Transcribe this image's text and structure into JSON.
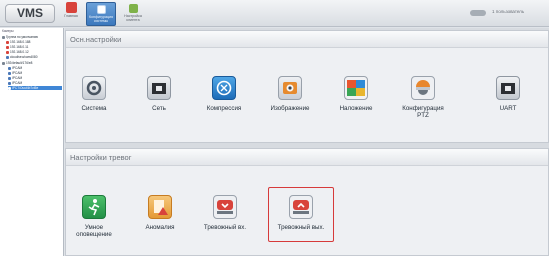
{
  "app": {
    "logo": "VMS"
  },
  "toolbar": {
    "buttons": [
      {
        "label": "Главная",
        "icon": "home-icon"
      },
      {
        "label": "Конфигурация системы",
        "icon": "config-icon"
      },
      {
        "label": "Настройка клиента",
        "icon": "client-icon"
      }
    ],
    "right_text": "1 пользователь"
  },
  "tree": {
    "header": "Камеры",
    "rows": [
      {
        "label": "Группа по умолчанию",
        "icon": "folder-icon"
      },
      {
        "label": "192.168.0.188",
        "icon": "camera-icon"
      },
      {
        "label": "192.168.0.11",
        "icon": "camera-icon"
      },
      {
        "label": "192.168.0.12",
        "icon": "camera-icon"
      },
      {
        "label": "cloudiveo/cam4080",
        "icon": "camera-icon"
      },
      {
        "label": "192/default/176/e8",
        "icon": "folder-icon"
      },
      {
        "label": "IPCAM",
        "icon": "camera-icon"
      },
      {
        "label": "IPCAM",
        "icon": "camera-icon"
      },
      {
        "label": "IPCAM",
        "icon": "camera-icon"
      },
      {
        "label": "IPCAM",
        "icon": "camera-icon"
      },
      {
        "label": "IPC7/Ouut4b7ct5e",
        "icon": "camera-icon"
      }
    ]
  },
  "main_settings": {
    "title": "Осн.настройки",
    "tiles": [
      {
        "label": "Система",
        "icon": "gear-icon"
      },
      {
        "label": "Сеть",
        "icon": "network-icon"
      },
      {
        "label": "Компрессия",
        "icon": "compression-icon"
      },
      {
        "label": "Изображение",
        "icon": "image-icon"
      },
      {
        "label": "Наложение",
        "icon": "overlay-icon"
      },
      {
        "label": "Конфигурация PTZ",
        "icon": "ptz-icon"
      },
      {
        "label": "UART",
        "icon": "uart-icon"
      }
    ]
  },
  "alarm_settings": {
    "title": "Настройки тревог",
    "tiles": [
      {
        "label": "Умное оповещение",
        "icon": "smart-alert-icon"
      },
      {
        "label": "Аномалия",
        "icon": "anomaly-icon"
      },
      {
        "label": "Тревожный вх.",
        "icon": "alarm-in-icon"
      },
      {
        "label": "Тревожный вых.",
        "icon": "alarm-out-icon"
      }
    ]
  },
  "colors": {
    "accent": "#3f86d6",
    "highlight_border": "#d63a3a"
  }
}
